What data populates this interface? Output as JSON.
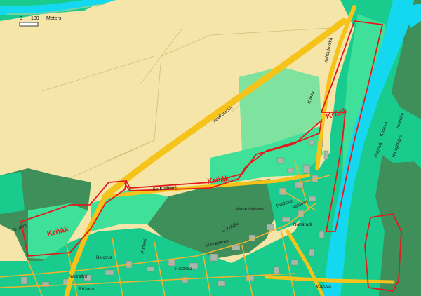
{
  "map": {
    "scale_bar": {
      "zero": "0",
      "length": "100",
      "unit": "Meters"
    },
    "area_labels": {
      "krnak_east": "Krňák",
      "krnak_middle": "Krňák",
      "krnak_west": "Krňák"
    },
    "street_labels": {
      "strakonicka": "Strakonická",
      "ke_krnaku": "Ke Krňáku",
      "k_vltave": "K Vltavě",
      "k_jezu": "K jezu",
      "kaltoulovska": "Kaltoulovská",
      "vlastovickova": "Vlastovickova",
      "prazska": "Pražská",
      "u_krnaku": "U Krňáku",
      "valdova": "Valdova",
      "naharadi": "Naháradí",
      "u_pramene": "U Pramene",
      "belcova": "Belcova",
      "prazska_south": "Pražská",
      "nadrazni": "Nádražní",
      "podlesi": "Podlesí",
      "ruzova": "Růžová",
      "vodova": "Vodova",
      "s_uziny": "S užiny",
      "dubova": "Dubová",
      "kosova": "Kosova",
      "na_vyhlidce": "Na výhlídce",
      "svateho": "Svatého"
    },
    "colors": {
      "background_field": "#f6e5a8",
      "urban_green": "#19cc8e",
      "forest_dark": "#3e8f5a",
      "park_light": "#3fe09a",
      "pale_green": "#7fe39f",
      "water": "#14d8ef",
      "road_major": "#f6c31a",
      "road_minor": "#f2b230",
      "boundary_red": "#e31a1c",
      "building": "#a9b7a8"
    }
  }
}
